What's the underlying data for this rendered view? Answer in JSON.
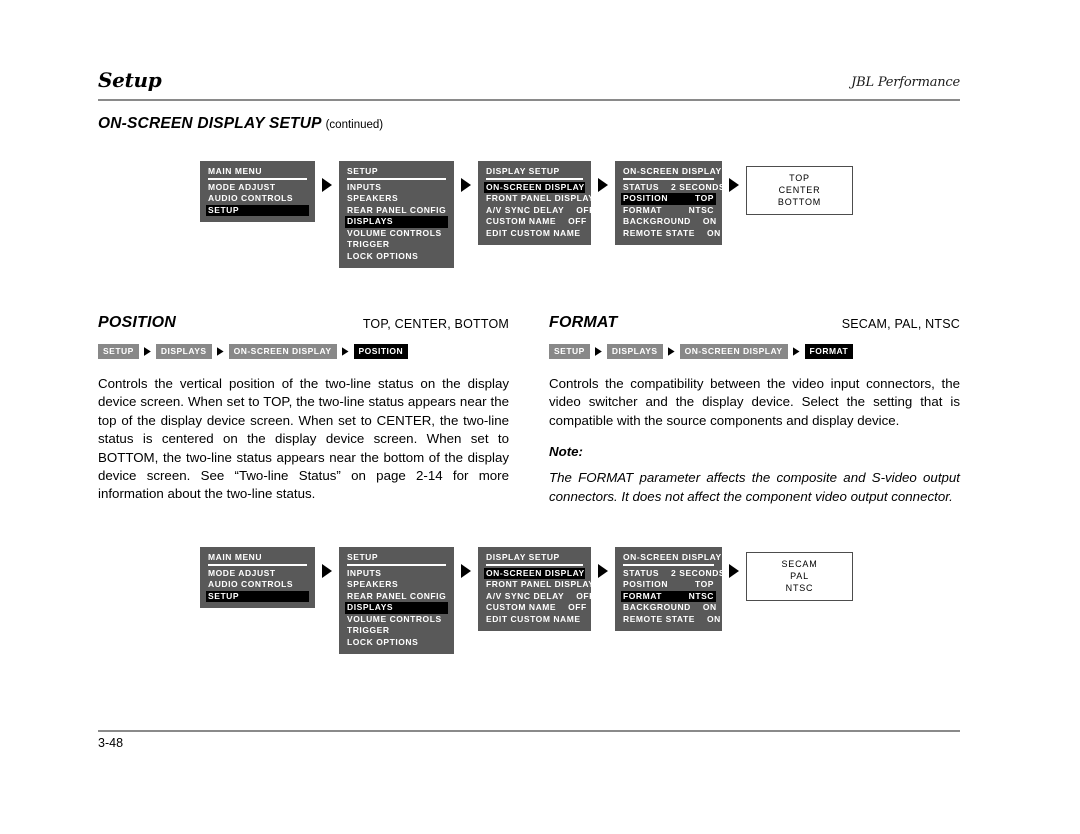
{
  "header": {
    "title": "Setup",
    "brand": "JBL Performance",
    "section_title": "ON-SCREEN DISPLAY SETUP",
    "section_continued": "(continued)"
  },
  "footer": {
    "page_number": "3-48"
  },
  "menus": {
    "main_menu": {
      "title": "MAIN MENU",
      "rows": [
        {
          "label": "MODE ADJUST",
          "value": "",
          "selected": false
        },
        {
          "label": "AUDIO CONTROLS",
          "value": "",
          "selected": false
        },
        {
          "label": "SETUP",
          "value": "",
          "selected": true
        }
      ]
    },
    "setup": {
      "title": "SETUP",
      "rows": [
        {
          "label": "INPUTS",
          "value": "",
          "selected": false
        },
        {
          "label": "SPEAKERS",
          "value": "",
          "selected": false
        },
        {
          "label": "REAR PANEL CONFIG",
          "value": "",
          "selected": false
        },
        {
          "label": "DISPLAYS",
          "value": "",
          "selected": true
        },
        {
          "label": "VOLUME CONTROLS",
          "value": "",
          "selected": false
        },
        {
          "label": "TRIGGER",
          "value": "",
          "selected": false
        },
        {
          "label": "LOCK OPTIONS",
          "value": "",
          "selected": false
        }
      ]
    },
    "display_setup": {
      "title": "DISPLAY SETUP",
      "rows": [
        {
          "label": "ON-SCREEN DISPLAY",
          "value": "",
          "selected": true
        },
        {
          "label": "FRONT PANEL DISPLAY",
          "value": "",
          "selected": false
        },
        {
          "label": "A/V SYNC DELAY",
          "value": "OFF",
          "selected": false
        },
        {
          "label": "CUSTOM NAME",
          "value": "OFF",
          "selected": false
        },
        {
          "label": "EDIT CUSTOM NAME",
          "value": "",
          "selected": false
        }
      ]
    },
    "osd_position": {
      "title": "ON-SCREEN DISPLAY",
      "rows": [
        {
          "label": "STATUS",
          "value": "2 SECONDS",
          "selected": false
        },
        {
          "label": "POSITION",
          "value": "TOP",
          "selected": true
        },
        {
          "label": "FORMAT",
          "value": "NTSC",
          "selected": false
        },
        {
          "label": "BACKGROUND",
          "value": "ON",
          "selected": false
        },
        {
          "label": "REMOTE STATE",
          "value": "ON",
          "selected": false
        }
      ]
    },
    "osd_format": {
      "title": "ON-SCREEN DISPLAY",
      "rows": [
        {
          "label": "STATUS",
          "value": "2 SECONDS",
          "selected": false
        },
        {
          "label": "POSITION",
          "value": "TOP",
          "selected": false
        },
        {
          "label": "FORMAT",
          "value": "NTSC",
          "selected": true
        },
        {
          "label": "BACKGROUND",
          "value": "ON",
          "selected": false
        },
        {
          "label": "REMOTE STATE",
          "value": "ON",
          "selected": false
        }
      ]
    },
    "position_options": {
      "lines": [
        "TOP",
        "CENTER",
        "BOTTOM"
      ]
    },
    "format_options": {
      "lines": [
        "SECAM",
        "PAL",
        "NTSC"
      ]
    }
  },
  "sections": {
    "position": {
      "name": "POSITION",
      "values": "TOP, CENTER, BOTTOM",
      "breadcrumb": [
        "SETUP",
        "DISPLAYS",
        "ON-SCREEN DISPLAY",
        "POSITION"
      ],
      "body": "Controls the vertical position of the two-line status on the display device screen. When set to TOP, the two-line status appears near the top of the display device screen. When set to CENTER, the two-line status is centered on the display device screen. When set to BOTTOM, the two-line status appears near the bottom of the display device screen. See “Two-line Status” on page 2-14 for more information about the two-line status."
    },
    "format": {
      "name": "FORMAT",
      "values": "SECAM, PAL, NTSC",
      "breadcrumb": [
        "SETUP",
        "DISPLAYS",
        "ON-SCREEN DISPLAY",
        "FORMAT"
      ],
      "body": "Controls the compatibility between the video input connectors, the video switcher and the display device. Select the setting that is compatible with the source components and display device.",
      "note_label": "Note:",
      "note_body": "The FORMAT parameter affects the composite and S-video output connectors. It does not affect the component video output connector."
    }
  }
}
